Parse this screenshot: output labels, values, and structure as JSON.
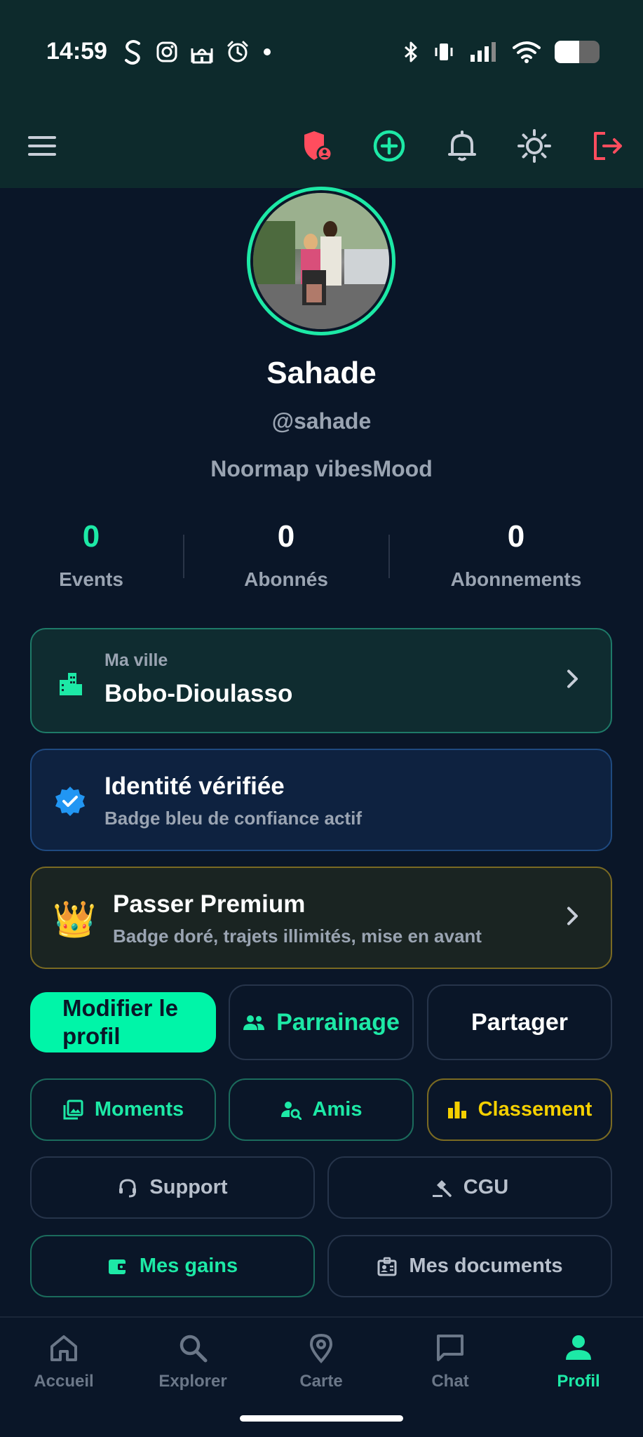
{
  "status_bar": {
    "time": "14:59",
    "battery_level": 0.55
  },
  "app_bar": {
    "menu_icon": "menu-icon",
    "security_icon": "shield-user-icon",
    "add_icon": "add-circle-icon",
    "notifications_icon": "bell-icon",
    "theme_icon": "sun-icon",
    "logout_icon": "logout-icon"
  },
  "profile": {
    "name": "Sahade",
    "handle": "@sahade",
    "bio": "Noormap vibesMood"
  },
  "stats": [
    {
      "value": "0",
      "label": "Events",
      "color": "#1de9a6"
    },
    {
      "value": "0",
      "label": "Abonnés",
      "color": "#ffffff"
    },
    {
      "value": "0",
      "label": "Abonnements",
      "color": "#ffffff"
    }
  ],
  "city_card": {
    "label": "Ma ville",
    "value": "Bobo-Dioulasso"
  },
  "identity_card": {
    "title": "Identité vérifiée",
    "subtitle": "Badge bleu de confiance actif"
  },
  "premium_card": {
    "icon": "👑",
    "title": "Passer Premium",
    "subtitle": "Badge doré, trajets illimités, mise en avant"
  },
  "actions": {
    "edit_profile": "Modifier le profil",
    "referral": "Parrainage",
    "share": "Partager",
    "moments": "Moments",
    "friends": "Amis",
    "ranking": "Classement",
    "support": "Support",
    "terms": "CGU",
    "earnings": "Mes gains",
    "documents": "Mes documents"
  },
  "nav": [
    {
      "label": "Accueil",
      "icon": "home-icon"
    },
    {
      "label": "Explorer",
      "icon": "search-icon"
    },
    {
      "label": "Carte",
      "icon": "map-pin-icon"
    },
    {
      "label": "Chat",
      "icon": "chat-icon"
    },
    {
      "label": "Profil",
      "icon": "person-icon"
    }
  ],
  "colors": {
    "accent": "#1de9a6",
    "background": "#0a1628",
    "gold": "#f5d000",
    "danger": "#ff4d5e",
    "verified": "#2196f3"
  }
}
